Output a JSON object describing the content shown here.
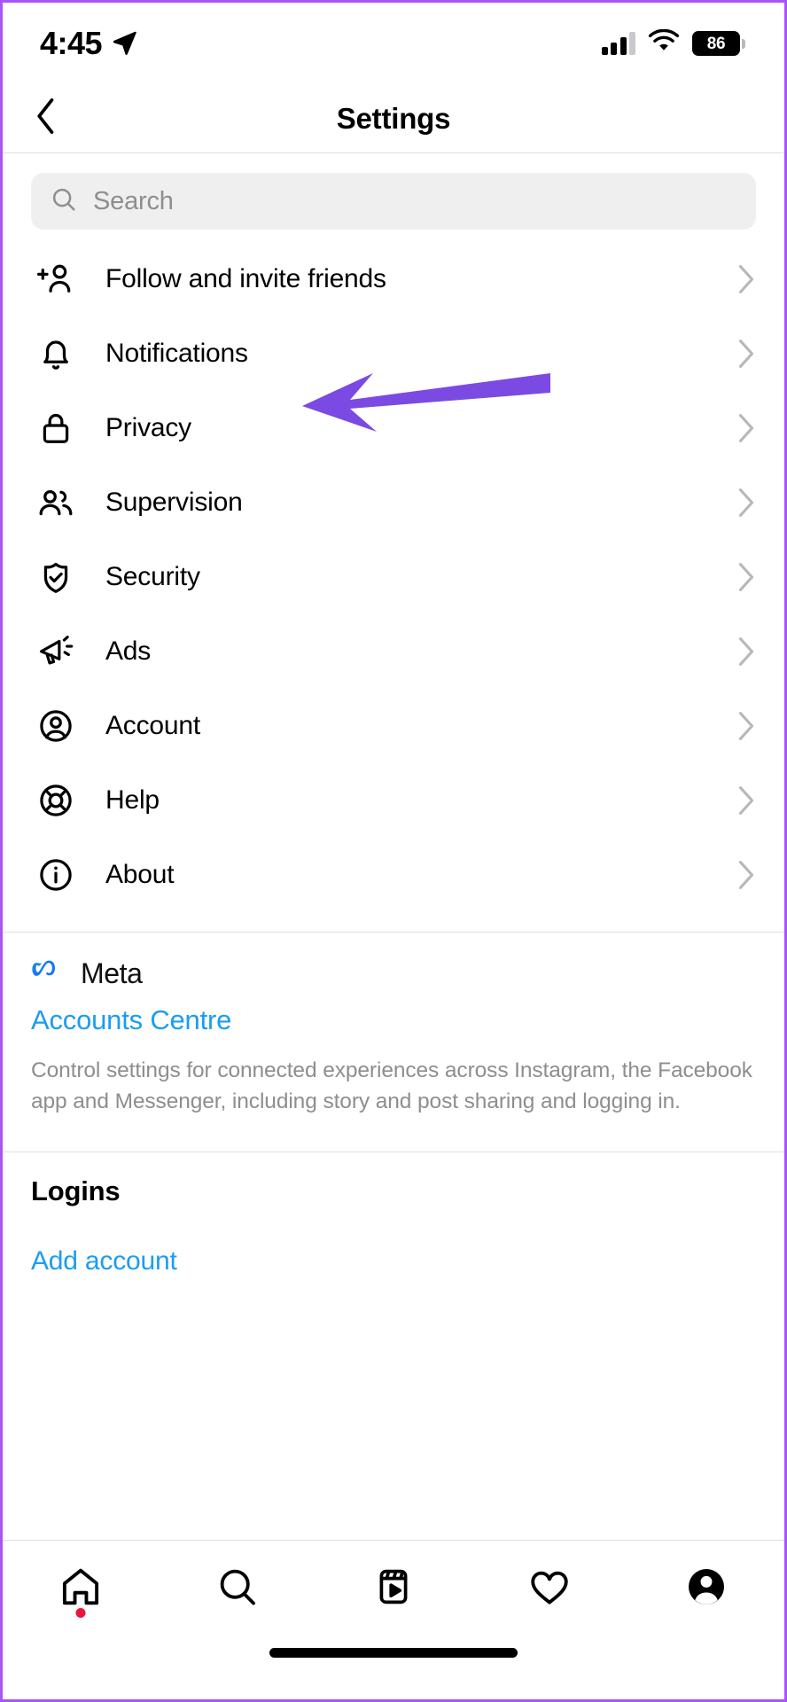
{
  "status_bar": {
    "time": "4:45",
    "location_icon": "location-arrow-icon",
    "signal_icon": "cellular-signal-icon",
    "signal_bars_filled": 3,
    "signal_bars_total": 4,
    "wifi_icon": "wifi-icon",
    "battery_level": "86",
    "battery_icon": "battery-icon"
  },
  "header": {
    "title": "Settings",
    "back_icon": "chevron-left-icon"
  },
  "search": {
    "placeholder": "Search",
    "icon": "search-icon",
    "value": ""
  },
  "settings_list": [
    {
      "label": "Follow and invite friends",
      "icon": "person-add-icon",
      "chevron": "chevron-right-icon"
    },
    {
      "label": "Notifications",
      "icon": "bell-icon",
      "chevron": "chevron-right-icon"
    },
    {
      "label": "Privacy",
      "icon": "lock-icon",
      "chevron": "chevron-right-icon"
    },
    {
      "label": "Supervision",
      "icon": "people-icon",
      "chevron": "chevron-right-icon"
    },
    {
      "label": "Security",
      "icon": "shield-check-icon",
      "chevron": "chevron-right-icon"
    },
    {
      "label": "Ads",
      "icon": "megaphone-icon",
      "chevron": "chevron-right-icon"
    },
    {
      "label": "Account",
      "icon": "account-circle-icon",
      "chevron": "chevron-right-icon"
    },
    {
      "label": "Help",
      "icon": "lifebuoy-icon",
      "chevron": "chevron-right-icon"
    },
    {
      "label": "About",
      "icon": "info-circle-icon",
      "chevron": "chevron-right-icon"
    }
  ],
  "meta_section": {
    "brand_icon": "meta-logo-icon",
    "brand_name": "Meta",
    "link_label": "Accounts Centre",
    "description": "Control settings for connected experiences across Instagram, the Facebook app and Messenger, including story and post sharing and logging in."
  },
  "logins_section": {
    "title": "Logins",
    "add_account_label": "Add account"
  },
  "tab_bar": [
    {
      "name": "home",
      "icon": "home-icon",
      "badge": true
    },
    {
      "name": "search",
      "icon": "search-icon",
      "badge": false
    },
    {
      "name": "reels",
      "icon": "reels-icon",
      "badge": false
    },
    {
      "name": "activity",
      "icon": "heart-icon",
      "badge": false
    },
    {
      "name": "profile",
      "icon": "profile-avatar-icon",
      "badge": false
    }
  ],
  "annotation": {
    "type": "arrow",
    "color": "#7b4ae2",
    "points_to": "Notifications"
  },
  "colors": {
    "accent_link": "#1b9df0",
    "meta_blue": "#1877f2",
    "annotation_purple": "#7b4ae2",
    "badge_red": "#e8173d",
    "search_bg": "#efefef",
    "muted_text": "#8e8e8e",
    "frame_border": "#a855f7"
  }
}
